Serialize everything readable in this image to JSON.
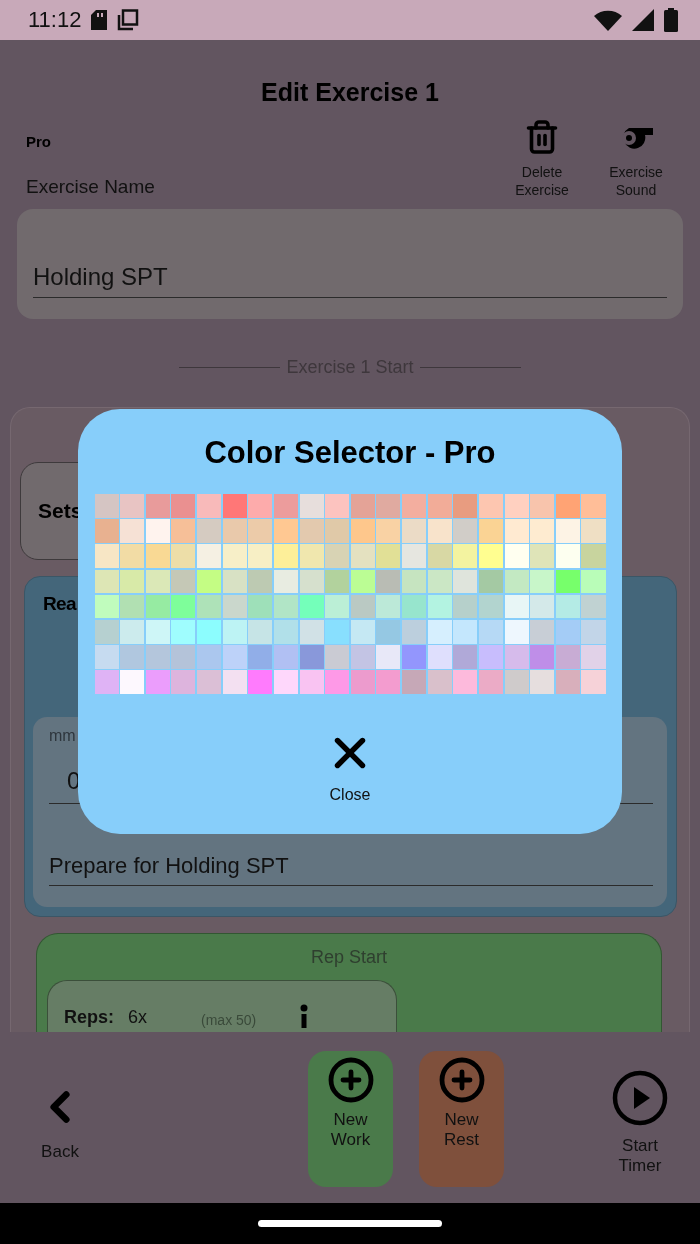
{
  "status_bar": {
    "time": "11:12"
  },
  "header": {
    "title": "Edit Exercise 1",
    "tier": "Pro",
    "name_label": "Exercise Name",
    "actions": [
      {
        "kind": "delete",
        "label": "Delete Exercise"
      },
      {
        "kind": "sound",
        "label": "Exercise Sound"
      }
    ]
  },
  "name_field": {
    "value": "Holding SPT"
  },
  "section_divider": "Exercise 1 Start",
  "sets_card": {
    "label": "Sets"
  },
  "rest_card": {
    "label": "Rea",
    "time_label": "mm",
    "time_value": "0",
    "description": "Prepare for Holding SPT"
  },
  "rep_card": {
    "title": "Rep Start",
    "reps_label": "Reps:",
    "reps_value": "6x",
    "reps_max": "(max 50)"
  },
  "dialog": {
    "title": "Color Selector - Pro",
    "close_label": "Close",
    "swatch_rows": [
      [
        {
          "color": "#d5c5c3"
        },
        {
          "color": "#e8c4c3"
        },
        {
          "color": "#e89b9b"
        },
        {
          "color": "#ea9090"
        },
        {
          "color": "#f8baba"
        },
        {
          "color": "#ff7777"
        },
        {
          "color": "#fdabab"
        },
        {
          "color": "#ec9c9c"
        },
        {
          "color": "#e7dedc"
        },
        {
          "color": "#fcc3bf"
        },
        {
          "color": "#e4a397"
        },
        {
          "color": "#e0aaa0"
        },
        {
          "color": "#f3ae9f"
        },
        {
          "color": "#f2ac98"
        },
        {
          "color": "#e89c80"
        },
        {
          "color": "#fdc6b0"
        },
        {
          "color": "#ffd0c0"
        },
        {
          "color": "#f8c4ac"
        },
        {
          "color": "#ffa374"
        },
        {
          "color": "#ffbe98"
        }
      ],
      [
        {
          "color": "#e8b190"
        },
        {
          "color": "#f6e1d5"
        },
        {
          "color": "#fff3ee"
        },
        {
          "color": "#f6bf98"
        },
        {
          "color": "#d5cbc1"
        },
        {
          "color": "#e9c9ab"
        },
        {
          "color": "#eccba9"
        },
        {
          "color": "#ffc892"
        },
        {
          "color": "#e3c9ae"
        },
        {
          "color": "#e0c9a8"
        },
        {
          "color": "#fec78c"
        },
        {
          "color": "#f9d2a4"
        },
        {
          "color": "#ebdbc6"
        },
        {
          "color": "#f8e3cb"
        },
        {
          "color": "#d1cdc8"
        },
        {
          "color": "#fad394"
        },
        {
          "color": "#ffead1"
        },
        {
          "color": "#feebd0"
        },
        {
          "color": "#fdf3e5"
        },
        {
          "color": "#efdfc4"
        }
      ],
      [
        {
          "color": "#f7e6c5"
        },
        {
          "color": "#f2dca5"
        },
        {
          "color": "#f9d994"
        },
        {
          "color": "#eddea8"
        },
        {
          "color": "#f5f0e3"
        },
        {
          "color": "#f7efc8"
        },
        {
          "color": "#f7efc5"
        },
        {
          "color": "#fdef99"
        },
        {
          "color": "#f0e7ae"
        },
        {
          "color": "#d8d3b4"
        },
        {
          "color": "#e4e1c0"
        },
        {
          "color": "#e1e096"
        },
        {
          "color": "#e6e6e0"
        },
        {
          "color": "#d8d8a4"
        },
        {
          "color": "#f3f3a0"
        },
        {
          "color": "#fffe90"
        },
        {
          "color": "#fffff0"
        },
        {
          "color": "#dfe4b8"
        },
        {
          "color": "#fdfff0"
        },
        {
          "color": "#c8d49e"
        }
      ],
      [
        {
          "color": "#dde6b5"
        },
        {
          "color": "#d8eaa8"
        },
        {
          "color": "#dbe8b7"
        },
        {
          "color": "#c5c8b6"
        },
        {
          "color": "#c4fd84"
        },
        {
          "color": "#d8e1c4"
        },
        {
          "color": "#bdcab2"
        },
        {
          "color": "#e8ece1"
        },
        {
          "color": "#d6e0cd"
        },
        {
          "color": "#b2d29d"
        },
        {
          "color": "#bbfd94"
        },
        {
          "color": "#b9bcb4"
        },
        {
          "color": "#c6e4c0"
        },
        {
          "color": "#cbe7c5"
        },
        {
          "color": "#dfe4dc"
        },
        {
          "color": "#a4c9a3"
        },
        {
          "color": "#c3e9c2"
        },
        {
          "color": "#c8f6c9"
        },
        {
          "color": "#77ff6b"
        },
        {
          "color": "#b9fdb8"
        }
      ],
      [
        {
          "color": "#c0fcbd"
        },
        {
          "color": "#b1e0b2"
        },
        {
          "color": "#96eba2"
        },
        {
          "color": "#7efe9a"
        },
        {
          "color": "#aee2b8"
        },
        {
          "color": "#cad7cc"
        },
        {
          "color": "#9ee0b9"
        },
        {
          "color": "#b1e5c6"
        },
        {
          "color": "#74ffba"
        },
        {
          "color": "#bbefd6"
        },
        {
          "color": "#bac9c3"
        },
        {
          "color": "#bce9d8"
        },
        {
          "color": "#97e5cd"
        },
        {
          "color": "#b3f3e1"
        },
        {
          "color": "#b6d0cb"
        },
        {
          "color": "#b2d4cf"
        },
        {
          "color": "#e8f6f6"
        },
        {
          "color": "#d4e9e9"
        },
        {
          "color": "#b4ebe5"
        },
        {
          "color": "#c0d2d2"
        }
      ],
      [
        {
          "color": "#b6d0d0"
        },
        {
          "color": "#ccebed"
        },
        {
          "color": "#cef6f7"
        },
        {
          "color": "#9ffdfe"
        },
        {
          "color": "#8cfdfe"
        },
        {
          "color": "#bdf3f4"
        },
        {
          "color": "#c6e4e6"
        },
        {
          "color": "#b1e0e9"
        },
        {
          "color": "#d1e1e6"
        },
        {
          "color": "#88dffe"
        },
        {
          "color": "#c5e8f3"
        },
        {
          "color": "#95c8e3"
        },
        {
          "color": "#bccfdd"
        },
        {
          "color": "#d6effe"
        },
        {
          "color": "#c4e7fd"
        },
        {
          "color": "#b6d9f5"
        },
        {
          "color": "#eef7fe"
        },
        {
          "color": "#c8ced6"
        },
        {
          "color": "#a4ccf6"
        },
        {
          "color": "#c2d5e8"
        }
      ],
      [
        {
          "color": "#c6dbf0"
        },
        {
          "color": "#b0c7df"
        },
        {
          "color": "#b4c6dc"
        },
        {
          "color": "#b4c3d9"
        },
        {
          "color": "#abc7ee"
        },
        {
          "color": "#bdd2f9"
        },
        {
          "color": "#91aee8"
        },
        {
          "color": "#b1c0f3"
        },
        {
          "color": "#8998da"
        },
        {
          "color": "#cacbd3"
        },
        {
          "color": "#c3c4e4"
        },
        {
          "color": "#e8e8f8"
        },
        {
          "color": "#9396fd"
        },
        {
          "color": "#dfdffd"
        },
        {
          "color": "#b0a9d8"
        },
        {
          "color": "#c8bdfd"
        },
        {
          "color": "#d6bbeb"
        },
        {
          "color": "#bf8ee8"
        },
        {
          "color": "#c8acd4"
        },
        {
          "color": "#e1d2e8"
        }
      ],
      [
        {
          "color": "#dfb3f5"
        },
        {
          "color": "#fdf8fe"
        },
        {
          "color": "#eb9dfc"
        },
        {
          "color": "#ddb4dd"
        },
        {
          "color": "#dbbfd6"
        },
        {
          "color": "#f3e0f1"
        },
        {
          "color": "#ff7bfd"
        },
        {
          "color": "#fed7fb"
        },
        {
          "color": "#f9c3f2"
        },
        {
          "color": "#fe99e7"
        },
        {
          "color": "#ec9bcd"
        },
        {
          "color": "#f39ccf"
        },
        {
          "color": "#c6a8b7"
        },
        {
          "color": "#d9c0cb"
        },
        {
          "color": "#fdbadc"
        },
        {
          "color": "#ebabc6"
        },
        {
          "color": "#cfcbcb"
        },
        {
          "color": "#e6dede"
        },
        {
          "color": "#d8afbb"
        },
        {
          "color": "#f6d2d8"
        }
      ]
    ]
  },
  "bottom_bar": [
    {
      "kind": "back",
      "label": "Back"
    },
    {
      "kind": "work",
      "label": "New Work"
    },
    {
      "kind": "rest",
      "label": "New Rest"
    },
    {
      "kind": "start",
      "label": "Start Timer"
    }
  ]
}
